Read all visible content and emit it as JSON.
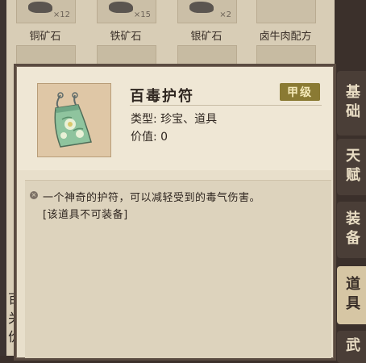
{
  "inventory": {
    "items": [
      {
        "name": "铜矿石",
        "qty": "×12"
      },
      {
        "name": "铁矿石",
        "qty": "×15"
      },
      {
        "name": "银矿石",
        "qty": "×2"
      },
      {
        "name": "卤牛肉配方",
        "qty": ""
      }
    ],
    "behind_text": [
      "百",
      "关",
      "价"
    ]
  },
  "tabs": [
    {
      "label": "基础"
    },
    {
      "label": "天赋"
    },
    {
      "label": "装备"
    },
    {
      "label": "道具"
    },
    {
      "label": "武"
    }
  ],
  "popup": {
    "item_name": "百毒护符",
    "grade": "甲级",
    "type_line": "类型: 珍宝、道具",
    "value_line": "价值: 0",
    "description": "一个神奇的护符，可以减轻受到的毒气伤害。",
    "note": "[该道具不可装备]",
    "icon": "amulet-icon"
  },
  "colors": {
    "grade_badge": "#8a7a33",
    "tab_active": "#d6c6a4",
    "tab_inactive": "#4a3e37",
    "amulet": "#8fc49e"
  }
}
